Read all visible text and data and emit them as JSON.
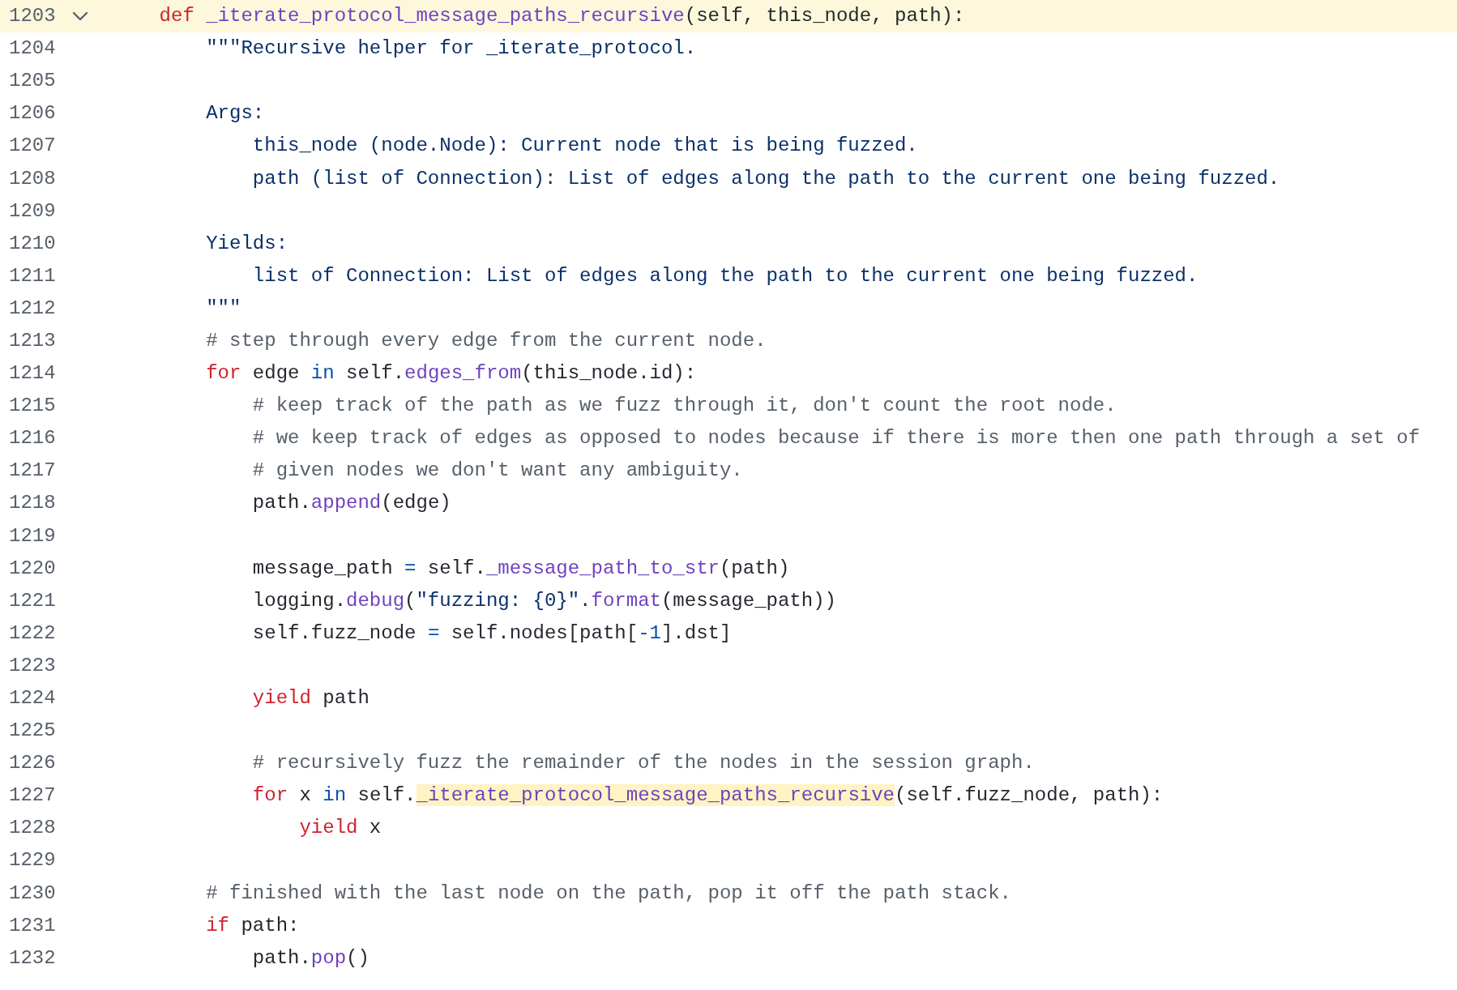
{
  "editor": {
    "lines": [
      {
        "number": "1203",
        "current": true,
        "fold": true,
        "tokens": [
          {
            "kind": "keyword",
            "text": "    def"
          },
          {
            "kind": "function",
            "text": " _iterate_protocol_message_paths_recursive"
          },
          {
            "kind": "plain",
            "text": "(self, this_node, path):"
          }
        ]
      },
      {
        "number": "1204",
        "current": false,
        "fold": false,
        "tokens": [
          {
            "kind": "string",
            "text": "        \"\"\"Recursive helper for _iterate_protocol."
          }
        ]
      },
      {
        "number": "1205",
        "current": false,
        "fold": false
      },
      {
        "number": "1206",
        "current": false,
        "fold": false,
        "tokens": [
          {
            "kind": "string",
            "text": "        Args:"
          }
        ]
      },
      {
        "number": "1207",
        "current": false,
        "fold": false,
        "tokens": [
          {
            "kind": "string",
            "text": "            this_node (node.Node): Current node that is being fuzzed."
          }
        ]
      },
      {
        "number": "1208",
        "current": false,
        "fold": false,
        "tokens": [
          {
            "kind": "string",
            "text": "            path (list of Connection): List of edges along the path to the current one being fuzzed."
          }
        ]
      },
      {
        "number": "1209",
        "current": false,
        "fold": false
      },
      {
        "number": "1210",
        "current": false,
        "fold": false,
        "tokens": [
          {
            "kind": "string",
            "text": "        Yields:"
          }
        ]
      },
      {
        "number": "1211",
        "current": false,
        "fold": false,
        "tokens": [
          {
            "kind": "string",
            "text": "            list of Connection: List of edges along the path to the current one being fuzzed."
          }
        ]
      },
      {
        "number": "1212",
        "current": false,
        "fold": false,
        "tokens": [
          {
            "kind": "string",
            "text": "        \"\"\""
          }
        ]
      },
      {
        "number": "1213",
        "current": false,
        "fold": false,
        "tokens": [
          {
            "kind": "comment",
            "text": "        # step through every edge from the current node."
          }
        ]
      },
      {
        "number": "1214",
        "current": false,
        "fold": false,
        "tokens": [
          {
            "kind": "keyword",
            "text": "        for"
          },
          {
            "kind": "plain",
            "text": " edge "
          },
          {
            "kind": "operator",
            "text": "in"
          },
          {
            "kind": "plain",
            "text": " self."
          },
          {
            "kind": "function",
            "text": "edges_from"
          },
          {
            "kind": "plain",
            "text": "(this_node.id):"
          }
        ]
      },
      {
        "number": "1215",
        "current": false,
        "fold": false,
        "tokens": [
          {
            "kind": "comment",
            "text": "            # keep track of the path as we fuzz through it, don't count the root node."
          }
        ]
      },
      {
        "number": "1216",
        "current": false,
        "fold": false,
        "tokens": [
          {
            "kind": "comment",
            "text": "            # we keep track of edges as opposed to nodes because if there is more then one path through a set of"
          }
        ]
      },
      {
        "number": "1217",
        "current": false,
        "fold": false,
        "tokens": [
          {
            "kind": "comment",
            "text": "            # given nodes we don't want any ambiguity."
          }
        ]
      },
      {
        "number": "1218",
        "current": false,
        "fold": false,
        "tokens": [
          {
            "kind": "plain",
            "text": "            path."
          },
          {
            "kind": "function",
            "text": "append"
          },
          {
            "kind": "plain",
            "text": "(edge)"
          }
        ]
      },
      {
        "number": "1219",
        "current": false,
        "fold": false
      },
      {
        "number": "1220",
        "current": false,
        "fold": false,
        "tokens": [
          {
            "kind": "plain",
            "text": "            message_path "
          },
          {
            "kind": "operator",
            "text": "="
          },
          {
            "kind": "plain",
            "text": " self."
          },
          {
            "kind": "function",
            "text": "_message_path_to_str"
          },
          {
            "kind": "plain",
            "text": "(path)"
          }
        ]
      },
      {
        "number": "1221",
        "current": false,
        "fold": false,
        "tokens": [
          {
            "kind": "plain",
            "text": "            logging."
          },
          {
            "kind": "function",
            "text": "debug"
          },
          {
            "kind": "plain",
            "text": "("
          },
          {
            "kind": "string",
            "text": "\"fuzzing: {0}\""
          },
          {
            "kind": "plain",
            "text": "."
          },
          {
            "kind": "function",
            "text": "format"
          },
          {
            "kind": "plain",
            "text": "(message_path))"
          }
        ]
      },
      {
        "number": "1222",
        "current": false,
        "fold": false,
        "tokens": [
          {
            "kind": "plain",
            "text": "            self.fuzz_node "
          },
          {
            "kind": "operator",
            "text": "="
          },
          {
            "kind": "plain",
            "text": " self.nodes[path["
          },
          {
            "kind": "operator",
            "text": "-1"
          },
          {
            "kind": "plain",
            "text": "].dst]"
          }
        ]
      },
      {
        "number": "1223",
        "current": false,
        "fold": false
      },
      {
        "number": "1224",
        "current": false,
        "fold": false,
        "tokens": [
          {
            "kind": "keyword",
            "text": "            yield"
          },
          {
            "kind": "plain",
            "text": " path"
          }
        ]
      },
      {
        "number": "1225",
        "current": false,
        "fold": false
      },
      {
        "number": "1226",
        "current": false,
        "fold": false,
        "tokens": [
          {
            "kind": "comment",
            "text": "            # recursively fuzz the remainder of the nodes in the session graph."
          }
        ]
      },
      {
        "number": "1227",
        "current": false,
        "fold": false,
        "tokens": [
          {
            "kind": "keyword",
            "text": "            for"
          },
          {
            "kind": "plain",
            "text": " x "
          },
          {
            "kind": "operator",
            "text": "in"
          },
          {
            "kind": "plain",
            "text": " self."
          },
          {
            "kind": "match",
            "text": "_iterate_protocol_message_paths_recursive"
          },
          {
            "kind": "plain",
            "text": "(self.fuzz_node, path):"
          }
        ]
      },
      {
        "number": "1228",
        "current": false,
        "fold": false,
        "tokens": [
          {
            "kind": "keyword",
            "text": "                yield"
          },
          {
            "kind": "plain",
            "text": " x"
          }
        ]
      },
      {
        "number": "1229",
        "current": false,
        "fold": false
      },
      {
        "number": "1230",
        "current": false,
        "fold": false,
        "tokens": [
          {
            "kind": "comment",
            "text": "        # finished with the last node on the path, pop it off the path stack."
          }
        ]
      },
      {
        "number": "1231",
        "current": false,
        "fold": false,
        "tokens": [
          {
            "kind": "keyword",
            "text": "        if"
          },
          {
            "kind": "plain",
            "text": " path:"
          }
        ]
      },
      {
        "number": "1232",
        "current": false,
        "fold": false,
        "tokens": [
          {
            "kind": "plain",
            "text": "            path."
          },
          {
            "kind": "function",
            "text": "pop"
          },
          {
            "kind": "plain",
            "text": "()"
          }
        ]
      }
    ]
  }
}
